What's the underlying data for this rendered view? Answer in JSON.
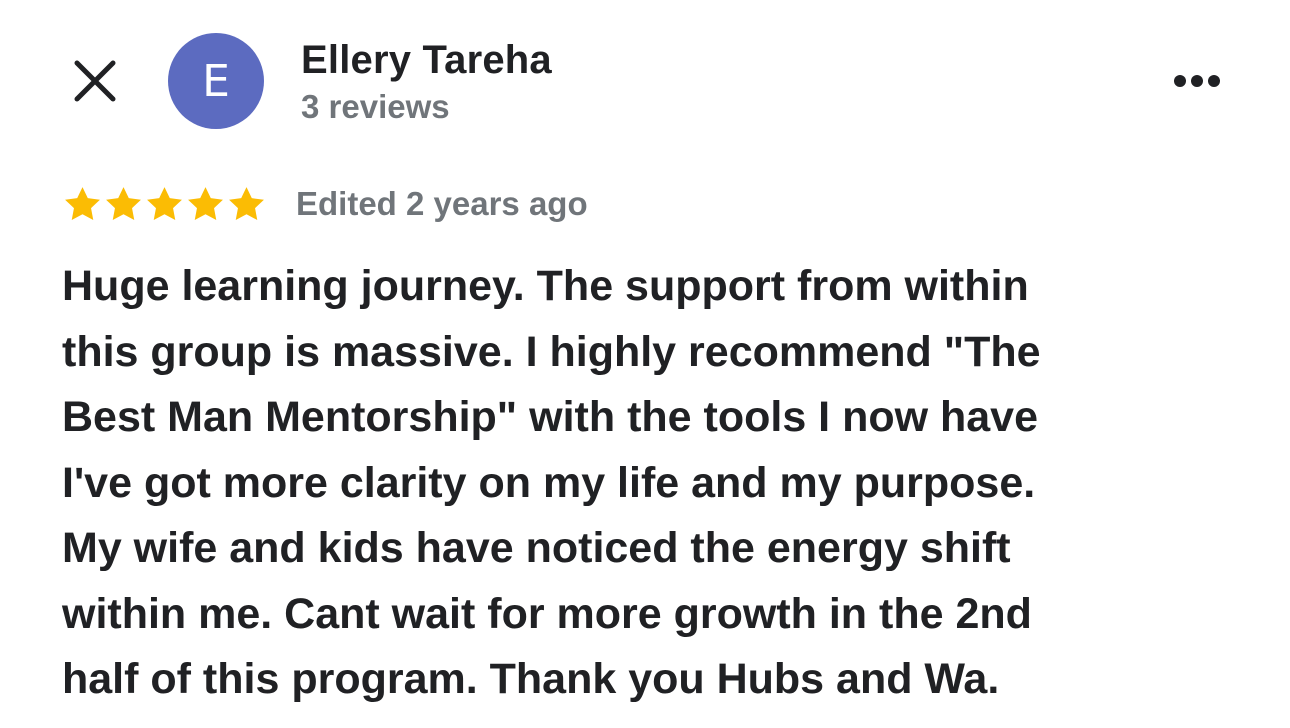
{
  "colors": {
    "avatar_bg": "#5c6bc0",
    "star": "#fbbc04",
    "primary_text": "#202124",
    "secondary_text": "#70757a"
  },
  "header": {
    "close_icon": "close-icon",
    "avatar_initial": "E",
    "reviewer_name": "Ellery Tareha",
    "review_count": "3 reviews",
    "more_icon": "more-horiz-icon"
  },
  "rating": {
    "stars": 5,
    "max_stars": 5,
    "timestamp": "Edited 2 years ago"
  },
  "review": {
    "lines": [
      "Huge learning journey. The support from within",
      "this group is massive. I highly recommend \"The",
      "Best Man Mentorship\" with the tools I now have",
      "I've got more clarity on my life and my purpose.",
      "My wife and kids have noticed the energy shift",
      "within me. Cant wait for more growth in the 2nd",
      "half of this program. Thank you Hubs and Wa."
    ]
  }
}
